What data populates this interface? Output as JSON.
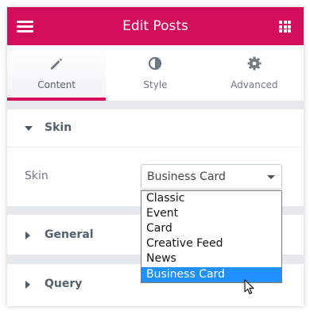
{
  "header": {
    "title": "Edit Posts",
    "menu_icon": "hamburger-menu-icon",
    "apps_icon": "grid-apps-icon",
    "background_color": "#d30c5c"
  },
  "tabs": [
    {
      "label": "Content",
      "icon": "pencil-icon",
      "active": true
    },
    {
      "label": "Style",
      "icon": "half-circle-contrast-icon",
      "active": false
    },
    {
      "label": "Advanced",
      "icon": "gear-icon",
      "active": false
    }
  ],
  "sections": {
    "skin": {
      "title": "Skin",
      "expanded": true
    },
    "general": {
      "title": "General",
      "expanded": false
    },
    "query": {
      "title": "Query",
      "expanded": false
    }
  },
  "skin_field": {
    "label": "Skin",
    "value": "Business Card",
    "options": [
      "Classic",
      "Event",
      "Card",
      "Creative Feed",
      "News",
      "Business Card"
    ],
    "highlighted_option": "Business Card"
  },
  "colors": {
    "accent": "#d30c5c",
    "selection": "#1e90ff"
  }
}
